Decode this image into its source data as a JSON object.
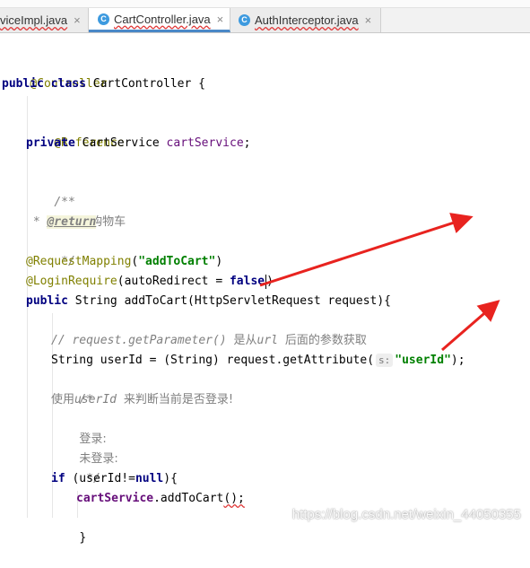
{
  "tabs": [
    {
      "label": "viceImpl.java",
      "close": "×",
      "active": false
    },
    {
      "label": "CartController.java",
      "close": "×",
      "active": true,
      "icon": "C"
    },
    {
      "label": "AuthInterceptor.java",
      "close": "×",
      "active": false,
      "icon": "C"
    }
  ],
  "code": {
    "l1_ann": "@Controller",
    "l2_kw1": "public",
    "l2_kw2": "class",
    "l2_rest": " CartController {",
    "l3_ann": "@Reference",
    "l4_kw": "private",
    "l4_type": " CartService ",
    "l4_field": "cartService",
    "l4_end": ";",
    "l5": "/**",
    "l6": " * 添加购物车",
    "l7_star": " * ",
    "l7_tag": "@return",
    "l8": " */",
    "l9_ann": "@RequestMapping",
    "l9_open": "(",
    "l9_str": "\"addToCart\"",
    "l9_close": ")",
    "l10_ann": "@LoginRequire",
    "l10_rest": "(autoRedirect = ",
    "l10_kw": "false",
    "l10_close": ")",
    "l11_kw": "public",
    "l11_rest": " String addToCart(HttpServletRequest request){",
    "l12_cmt": "// request.getParameter() ",
    "l12_cjk1": "是从",
    "l12_cmt2": "url ",
    "l12_cjk2": "后面的参数获取",
    "l13_a": "String userId = (String) request.getAttribute(",
    "l13_hint": "s:",
    "l13_str": "\"userId\"",
    "l13_end": ");",
    "l14": "/*",
    "l15_a": "使用",
    "l15_b": "userId ",
    "l15_c": "来判断当前是否登录!",
    "l16": "登录:",
    "l17": "未登录:",
    "l18": " */",
    "l19_kw": "if",
    "l19_mid": " (userId!=",
    "l19_kw2": "null",
    "l19_end": "){",
    "l20_field": "cartService",
    "l20_mid": ".addToCart",
    "l20_end": "();",
    "l21": "}"
  },
  "watermark": "https://blog.csdn.net/weixin_44050355",
  "colors": {
    "annotation": "#808000",
    "keyword": "#000080",
    "string": "#008000",
    "comment": "#808080",
    "field": "#660e7a",
    "arrow": "#e8231f",
    "active_tab_underline": "#4a88c7"
  }
}
